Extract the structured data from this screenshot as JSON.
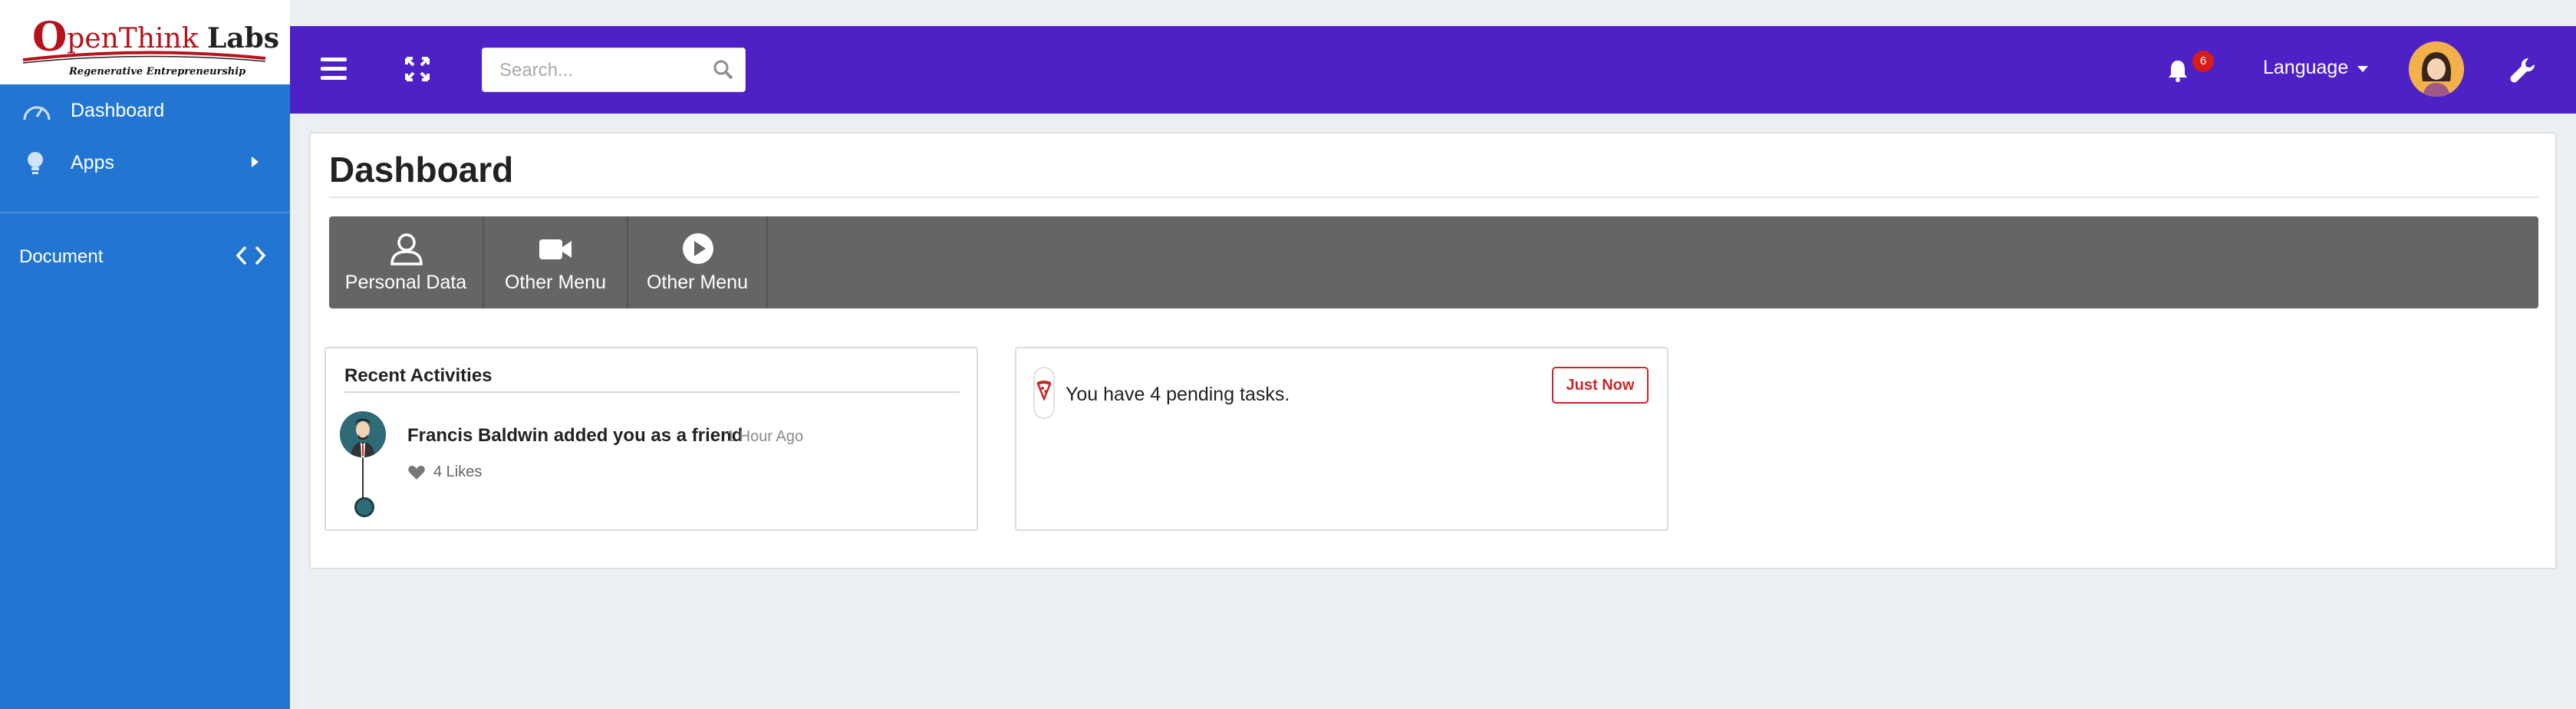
{
  "brand": {
    "name_first_letter": "O",
    "name_rest": "penThink",
    "name_suffix": "Labs",
    "tagline": "Regenerative Entrepreneurship",
    "accent": "#b5121b"
  },
  "sidebar": {
    "items": [
      {
        "label": "Dashboard",
        "icon": "dashboard-gauge-icon"
      },
      {
        "label": "Apps",
        "icon": "lightbulb-icon",
        "has_submenu": true
      }
    ],
    "document": {
      "label": "Document",
      "icon": "code-brackets-icon"
    },
    "color": "#2276d2"
  },
  "header": {
    "color": "#4e21c6",
    "search": {
      "placeholder": "Search...",
      "value": ""
    },
    "notifications": {
      "count": "6",
      "icon": "bell-icon"
    },
    "language_label": "Language",
    "icons": [
      "hamburger-menu-icon",
      "fullscreen-icon",
      "search-icon",
      "bell-icon",
      "wrench-icon"
    ]
  },
  "main": {
    "title": "Dashboard",
    "menu": [
      {
        "label": "Personal Data",
        "icon": "user-icon"
      },
      {
        "label": "Other Menu",
        "icon": "video-camera-icon"
      },
      {
        "label": "Other Menu",
        "icon": "play-circle-icon"
      }
    ],
    "recent": {
      "title": "Recent Activities",
      "activity_text": "Francis Baldwin added you as a friend",
      "activity_time": "1 Hour Ago",
      "likes": "4 Likes"
    },
    "tasks": {
      "text": "You have 4 pending tasks.",
      "button": "Just Now",
      "accent": "#c62828"
    }
  }
}
